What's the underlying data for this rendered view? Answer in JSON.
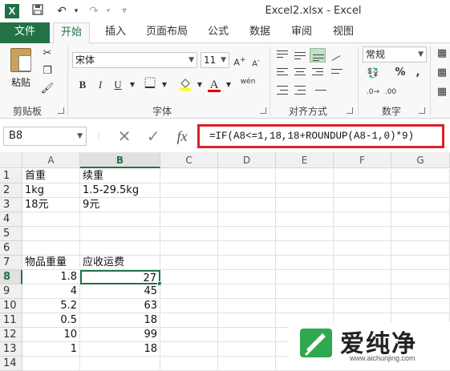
{
  "window": {
    "title": "Excel2.xlsx - Excel",
    "logo": "X"
  },
  "quick_access": {
    "save_icon": "save-icon",
    "undo_icon": "undo-icon",
    "redo_icon": "redo-icon",
    "customize_icon": "customize-icon"
  },
  "tabs": [
    {
      "label": "文件",
      "state": "file"
    },
    {
      "label": "开始",
      "state": "active"
    },
    {
      "label": "插入",
      "state": ""
    },
    {
      "label": "页面布局",
      "state": ""
    },
    {
      "label": "公式",
      "state": ""
    },
    {
      "label": "数据",
      "state": ""
    },
    {
      "label": "审阅",
      "state": ""
    },
    {
      "label": "视图",
      "state": ""
    }
  ],
  "ribbon": {
    "clipboard": {
      "paste_label": "粘贴",
      "group_label": "剪贴板"
    },
    "font": {
      "font_name": "宋体",
      "font_size": "11",
      "bold": "B",
      "italic": "I",
      "underline": "U",
      "font_color_glyph": "A",
      "wen": "wén",
      "group_label": "字体"
    },
    "alignment": {
      "group_label": "对齐方式"
    },
    "number": {
      "format": "常规",
      "percent": "%",
      "comma": ",",
      "group_label": "数字"
    }
  },
  "formula_bar": {
    "name_box": "B8",
    "cancel_glyph": "✕",
    "enter_glyph": "✓",
    "fx_label": "fx",
    "formula": "=IF(A8<=1,18,18+ROUNDUP(A8-1,0)*9)",
    "highlight_color": "#d8232a"
  },
  "sheet": {
    "columns": [
      "A",
      "B",
      "C",
      "D",
      "E",
      "F",
      "G"
    ],
    "selected_column": "B",
    "selected_row": "8",
    "rows": [
      {
        "n": "1",
        "A": "首重",
        "B": "续重"
      },
      {
        "n": "2",
        "A": "1kg",
        "B": "1.5-29.5kg"
      },
      {
        "n": "3",
        "A": "18元",
        "B": "9元"
      },
      {
        "n": "4",
        "A": "",
        "B": ""
      },
      {
        "n": "5",
        "A": "",
        "B": ""
      },
      {
        "n": "6",
        "A": "",
        "B": ""
      },
      {
        "n": "7",
        "A": "物品重量",
        "B": "应收运费"
      },
      {
        "n": "8",
        "A": "1.8",
        "B": "27"
      },
      {
        "n": "9",
        "A": "4",
        "B": "45"
      },
      {
        "n": "10",
        "A": "5.2",
        "B": "63"
      },
      {
        "n": "11",
        "A": "0.5",
        "B": "18"
      },
      {
        "n": "12",
        "A": "10",
        "B": "99"
      },
      {
        "n": "13",
        "A": "1",
        "B": "18"
      },
      {
        "n": "14",
        "A": "",
        "B": ""
      }
    ]
  },
  "watermark": {
    "text": "爱纯净",
    "url": "www.aichunjing.com"
  }
}
